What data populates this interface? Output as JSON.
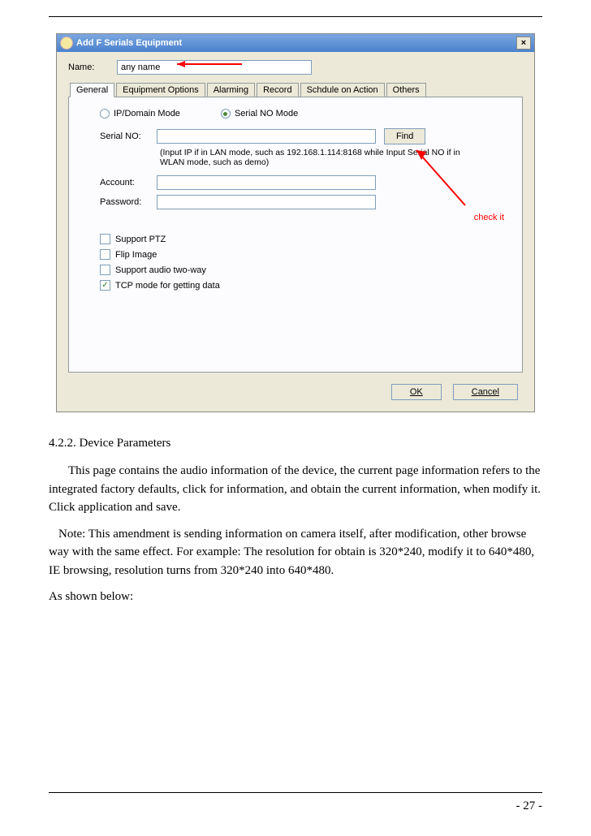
{
  "dialog": {
    "title": "Add F Serials Equipment",
    "name_label": "Name:",
    "name_value": "any name",
    "tabs": [
      "General",
      "Equipment Options",
      "Alarming",
      "Record",
      "Schdule on Action",
      "Others"
    ],
    "mode1": "IP/Domain Mode",
    "mode2": "Serial NO Mode",
    "serial_label": "Serial NO:",
    "find_label": "Find",
    "hint_text": "(Input IP if in LAN mode, such as 192.168.1.114:8168 while Input Serial NO if in WLAN mode, such as demo)",
    "account_label": "Account:",
    "password_label": "Password:",
    "cb1": "Support PTZ",
    "cb2": "Flip Image",
    "cb3": "Support audio two-way",
    "cb4": "TCP mode for getting data",
    "ok_label": "OK",
    "cancel_label": "Cancel",
    "annotation_checkit": "check it"
  },
  "doc": {
    "section_heading": "4.2.2. Device Parameters",
    "para1": "This page contains the audio information of the device, the current page information refers to the integrated factory defaults, click for information, and obtain the current information, when modify it. Click application and save.",
    "para2": "Note: This amendment is sending information on camera itself, after modification, other browse way with the same effect. For example: The resolution for obtain is 320*240, modify it to 640*480, IE browsing, resolution turns from 320*240 into 640*480.",
    "para3": "As shown below:",
    "page_number": "- 27 -"
  }
}
